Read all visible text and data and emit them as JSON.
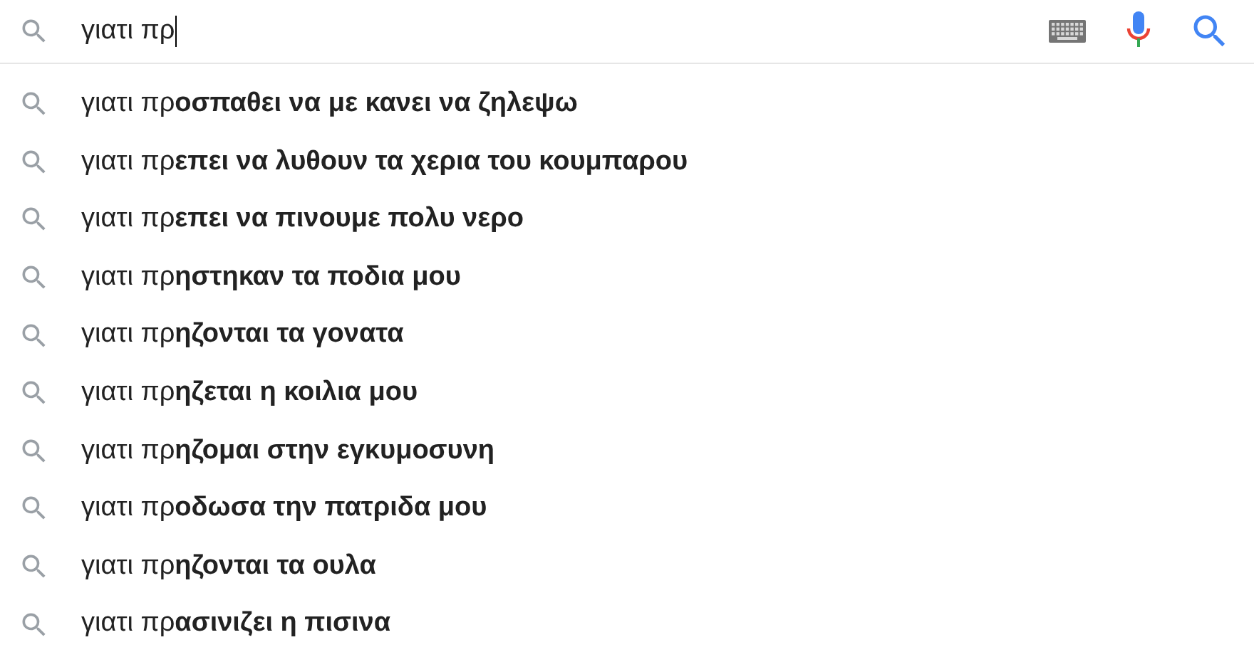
{
  "search": {
    "value": "γιατι πρ"
  },
  "suggestions": [
    {
      "text": "γιατι πρ**οσπαθει να με κανει να ζηλεψω**"
    },
    {
      "text": "γιατι πρ**επει να λυθουν τα χερια του κουμπαρου**"
    },
    {
      "text": "γιατι πρ**επει να πινουμε πολυ νερο**"
    },
    {
      "text": "γιατι πρ**ηστηκαν τα ποδια μου**"
    },
    {
      "text": "γιατι πρ**ηζονται τα γονατα**"
    },
    {
      "text": "γιατι πρ**ηζεται η κοιλια μου**"
    },
    {
      "text": "γιατι πρ**ηζομαι στην εγκυμοσυνη**"
    },
    {
      "text": "γιατι πρ**οδωσα την πατριδα μου**"
    },
    {
      "text": "γιατι πρ**ηζονται τα ουλα**"
    },
    {
      "text": "γιατι πρ**ασινιζει η πισινα**"
    }
  ]
}
